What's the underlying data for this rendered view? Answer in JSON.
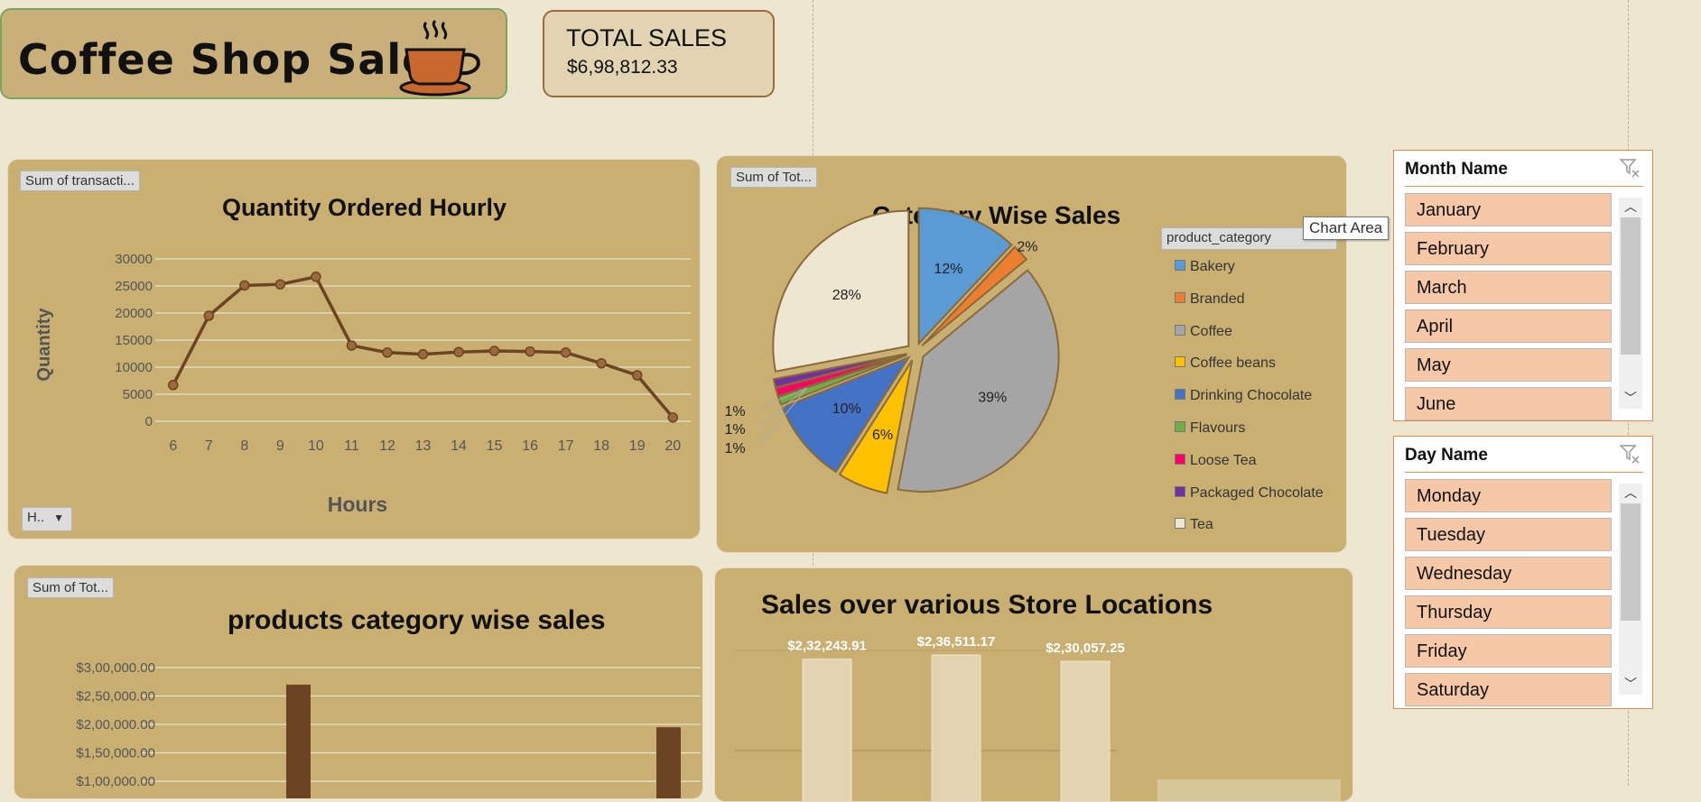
{
  "header": {
    "title": "Coffee Shop Sales",
    "total_sales_label": "TOTAL SALES",
    "total_sales_value": "$6,98,812.33",
    "cup_icon": "coffee-cup-icon"
  },
  "colors": {
    "background": "#efe6d2",
    "panel": "#c9b072",
    "line": "#6b4423",
    "slicer_item": "#f7c8a8",
    "bar_dark": "#6b4423",
    "bar_light": "#e2d4b0"
  },
  "charts": {
    "hourly": {
      "field_button": "Sum of transacti...",
      "axis_button": "H..",
      "title": "Quantity Ordered Hourly",
      "xlabel": "Hours",
      "ylabel": "Quantity"
    },
    "category": {
      "field_button": "Sum of Tot...",
      "title": "Category Wise Sales",
      "legend_button": "product_category"
    },
    "products": {
      "field_button": "Sum of Tot...",
      "title": "products category wise sales"
    },
    "stores": {
      "title": "Sales over various Store Locations"
    }
  },
  "chart_data": [
    {
      "type": "line",
      "title": "Quantity Ordered Hourly",
      "xlabel": "Hours",
      "ylabel": "Quantity",
      "x": [
        6,
        7,
        8,
        9,
        10,
        11,
        12,
        13,
        14,
        15,
        16,
        17,
        18,
        19,
        20
      ],
      "tick_labels": [
        "6",
        "7",
        "8",
        "9",
        "10",
        "11",
        "12",
        "13",
        "14",
        "15",
        "16",
        "17",
        "18",
        "19",
        "20"
      ],
      "values": [
        6700,
        19500,
        25100,
        25300,
        26700,
        14000,
        12700,
        12400,
        12800,
        13000,
        12900,
        12700,
        10700,
        8500,
        700
      ],
      "yticks": [
        "0",
        "5000",
        "10000",
        "15000",
        "20000",
        "25000",
        "30000"
      ],
      "ylim": [
        0,
        30000
      ],
      "grid": true
    },
    {
      "type": "pie",
      "title": "Category Wise Sales",
      "legend_title": "product_category",
      "legend_position": "right",
      "categories": [
        "Bakery",
        "Branded",
        "Coffee",
        "Coffee beans",
        "Drinking Chocolate",
        "Flavours",
        "Loose Tea",
        "Packaged Chocolate",
        "Tea"
      ],
      "values": [
        12,
        2,
        39,
        6,
        10,
        1,
        1,
        1,
        28
      ],
      "labels": [
        "12%",
        "2%",
        "39%",
        "6%",
        "10%",
        "1%",
        "1%",
        "1%",
        "28%"
      ],
      "colors": [
        "#5b9bd5",
        "#ed7d31",
        "#a5a5a5",
        "#ffc000",
        "#4472c4",
        "#70ad47",
        "#ff0066",
        "#7030a0",
        "#efe6d2"
      ]
    },
    {
      "type": "bar",
      "title": "products category wise sales",
      "yticks": [
        "$1,00,000.00",
        "$1,50,000.00",
        "$2,00,000.00",
        "$2,50,000.00",
        "$3,00,000.00"
      ],
      "values": [
        270000,
        195000
      ],
      "ylim": [
        100000,
        300000
      ],
      "grid": true
    },
    {
      "type": "bar",
      "title": "Sales over various Store Locations",
      "values": [
        232243.91,
        236511.17,
        230057.25
      ],
      "labels": [
        "$2,32,243.91",
        "$2,36,511.17",
        "$2,30,057.25"
      ],
      "grid": true
    }
  ],
  "slicers": {
    "month": {
      "title": "Month Name",
      "items": [
        "January",
        "February",
        "March",
        "April",
        "May",
        "June"
      ]
    },
    "day": {
      "title": "Day Name",
      "items": [
        "Monday",
        "Tuesday",
        "Wednesday",
        "Thursday",
        "Friday",
        "Saturday"
      ]
    }
  },
  "tooltip": "Chart Area"
}
